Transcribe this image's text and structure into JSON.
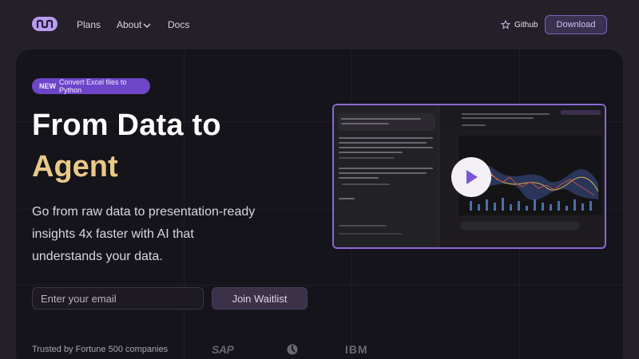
{
  "nav": {
    "plans": "Plans",
    "about": "About",
    "docs": "Docs",
    "github": "Github",
    "download": "Download"
  },
  "hero": {
    "badge_new": "NEW",
    "badge_text": "Convert Excel files to Python",
    "title_line1": "From Data to",
    "title_line2": "Agent",
    "subtitle": "Go from raw data to presentation-ready insights 4x faster with AI that understands your data.",
    "email_placeholder": "Enter your email",
    "join": "Join Waitlist",
    "trusted": "Trusted by Fortune 500 companies",
    "logos": [
      "SAP",
      "IBM"
    ]
  },
  "colors": {
    "accent": "#6d46c9",
    "gold": "#e9c987",
    "background": "#242029"
  },
  "icons": [
    "logo-icon",
    "chevron-down-icon",
    "star-icon",
    "play-icon"
  ]
}
